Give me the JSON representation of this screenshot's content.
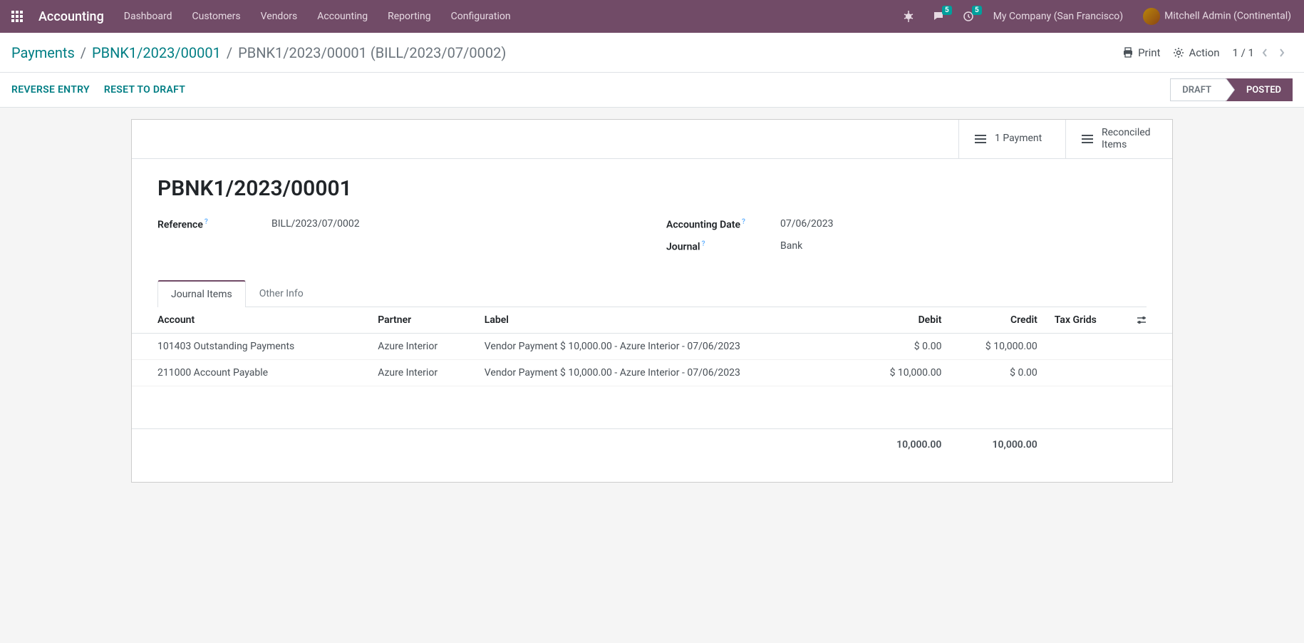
{
  "navbar": {
    "brand": "Accounting",
    "menu": [
      "Dashboard",
      "Customers",
      "Vendors",
      "Accounting",
      "Reporting",
      "Configuration"
    ],
    "messages_badge": "5",
    "activities_badge": "5",
    "company": "My Company (San Francisco)",
    "user": "Mitchell Admin (Continental)"
  },
  "breadcrumb": {
    "items": [
      "Payments",
      "PBNK1/2023/00001"
    ],
    "current": "PBNK1/2023/00001 (BILL/2023/07/0002)"
  },
  "control": {
    "print": "Print",
    "action": "Action",
    "pager": "1 / 1"
  },
  "status_bar": {
    "buttons": [
      "REVERSE ENTRY",
      "RESET TO DRAFT"
    ],
    "steps": [
      {
        "label": "DRAFT",
        "active": false
      },
      {
        "label": "POSTED",
        "active": true
      }
    ]
  },
  "stat_buttons": {
    "payment": "1 Payment",
    "reconciled_line1": "Reconciled",
    "reconciled_line2": "Items"
  },
  "record": {
    "title": "PBNK1/2023/00001",
    "fields": {
      "reference_label": "Reference",
      "reference_value": "BILL/2023/07/0002",
      "date_label": "Accounting Date",
      "date_value": "07/06/2023",
      "journal_label": "Journal",
      "journal_value": "Bank"
    }
  },
  "tabs": [
    "Journal Items",
    "Other Info"
  ],
  "table": {
    "headers": {
      "account": "Account",
      "partner": "Partner",
      "label": "Label",
      "debit": "Debit",
      "credit": "Credit",
      "tax_grids": "Tax Grids"
    },
    "rows": [
      {
        "account": "101403 Outstanding Payments",
        "partner": "Azure Interior",
        "label": "Vendor Payment $ 10,000.00 - Azure Interior - 07/06/2023",
        "debit": "$ 0.00",
        "credit": "$ 10,000.00",
        "tax_grids": ""
      },
      {
        "account": "211000 Account Payable",
        "partner": "Azure Interior",
        "label": "Vendor Payment $ 10,000.00 - Azure Interior - 07/06/2023",
        "debit": "$ 10,000.00",
        "credit": "$ 0.00",
        "tax_grids": ""
      }
    ],
    "totals": {
      "debit": "10,000.00",
      "credit": "10,000.00"
    }
  }
}
